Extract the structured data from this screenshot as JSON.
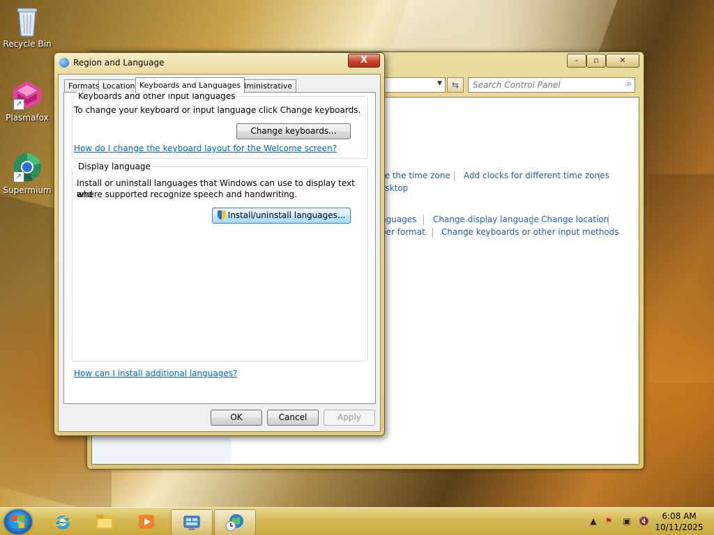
{
  "desktop": {
    "icons": [
      {
        "label": "Recycle Bin"
      },
      {
        "label": "Plasmafox"
      },
      {
        "label": "Supermium"
      }
    ]
  },
  "control_panel": {
    "search_placeholder": "Search Control Panel",
    "links": {
      "change_time_zone": "ge the time zone",
      "add_clocks": "Add clocks for different time zones",
      "desktop": "esktop",
      "languages": "nguages",
      "change_display_language": "Change display language",
      "change_location": "Change location",
      "number_format": "ber format",
      "change_keyboards": "Change keyboards or other input methods"
    }
  },
  "dialog": {
    "title": "Region and Language",
    "close_label": "X",
    "tabs": [
      {
        "label": "Formats"
      },
      {
        "label": "Location"
      },
      {
        "label": "Keyboards and Languages",
        "active": true
      },
      {
        "label": "Administrative"
      }
    ],
    "keyboards_group": {
      "title": "Keyboards and other input languages",
      "description": "To change your keyboard or input language click Change keyboards.",
      "button": "Change keyboards...",
      "link": "How do I change the keyboard layout for the Welcome screen?"
    },
    "display_group": {
      "title": "Display language",
      "description_line1": "Install or uninstall languages that Windows can use to display text and",
      "description_line2": "where supported recognize speech and handwriting.",
      "button": "Install/uninstall languages..."
    },
    "bottom_link": "How can I install additional languages?",
    "ok": "OK",
    "cancel": "Cancel",
    "apply": "Apply"
  },
  "taskbar": {
    "time": "6:08 AM",
    "date": "10/11/2025"
  }
}
